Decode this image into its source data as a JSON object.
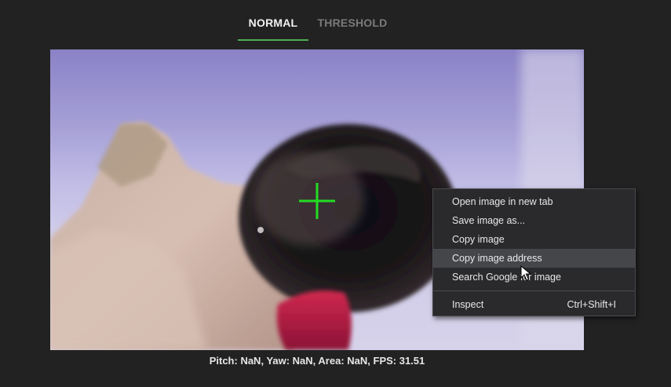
{
  "tabs": [
    {
      "label": "NORMAL",
      "active": true
    },
    {
      "label": "THRESHOLD",
      "active": false
    }
  ],
  "feed": {
    "crosshair_color": "#22dd22"
  },
  "status_text": "Pitch: NaN, Yaw: NaN, Area: NaN, FPS: 31.51",
  "context_menu": {
    "items": [
      {
        "label": "Open image in new tab"
      },
      {
        "label": "Save image as..."
      },
      {
        "label": "Copy image"
      },
      {
        "label": "Copy image address",
        "highlighted": true
      },
      {
        "label": "Search Google for image"
      }
    ],
    "inspect": {
      "label": "Inspect",
      "shortcut": "Ctrl+Shift+I"
    }
  },
  "colors": {
    "background": "#222222",
    "accent": "#4caf50",
    "menu_bg": "#2a2a2d",
    "menu_highlight": "#45464a"
  }
}
